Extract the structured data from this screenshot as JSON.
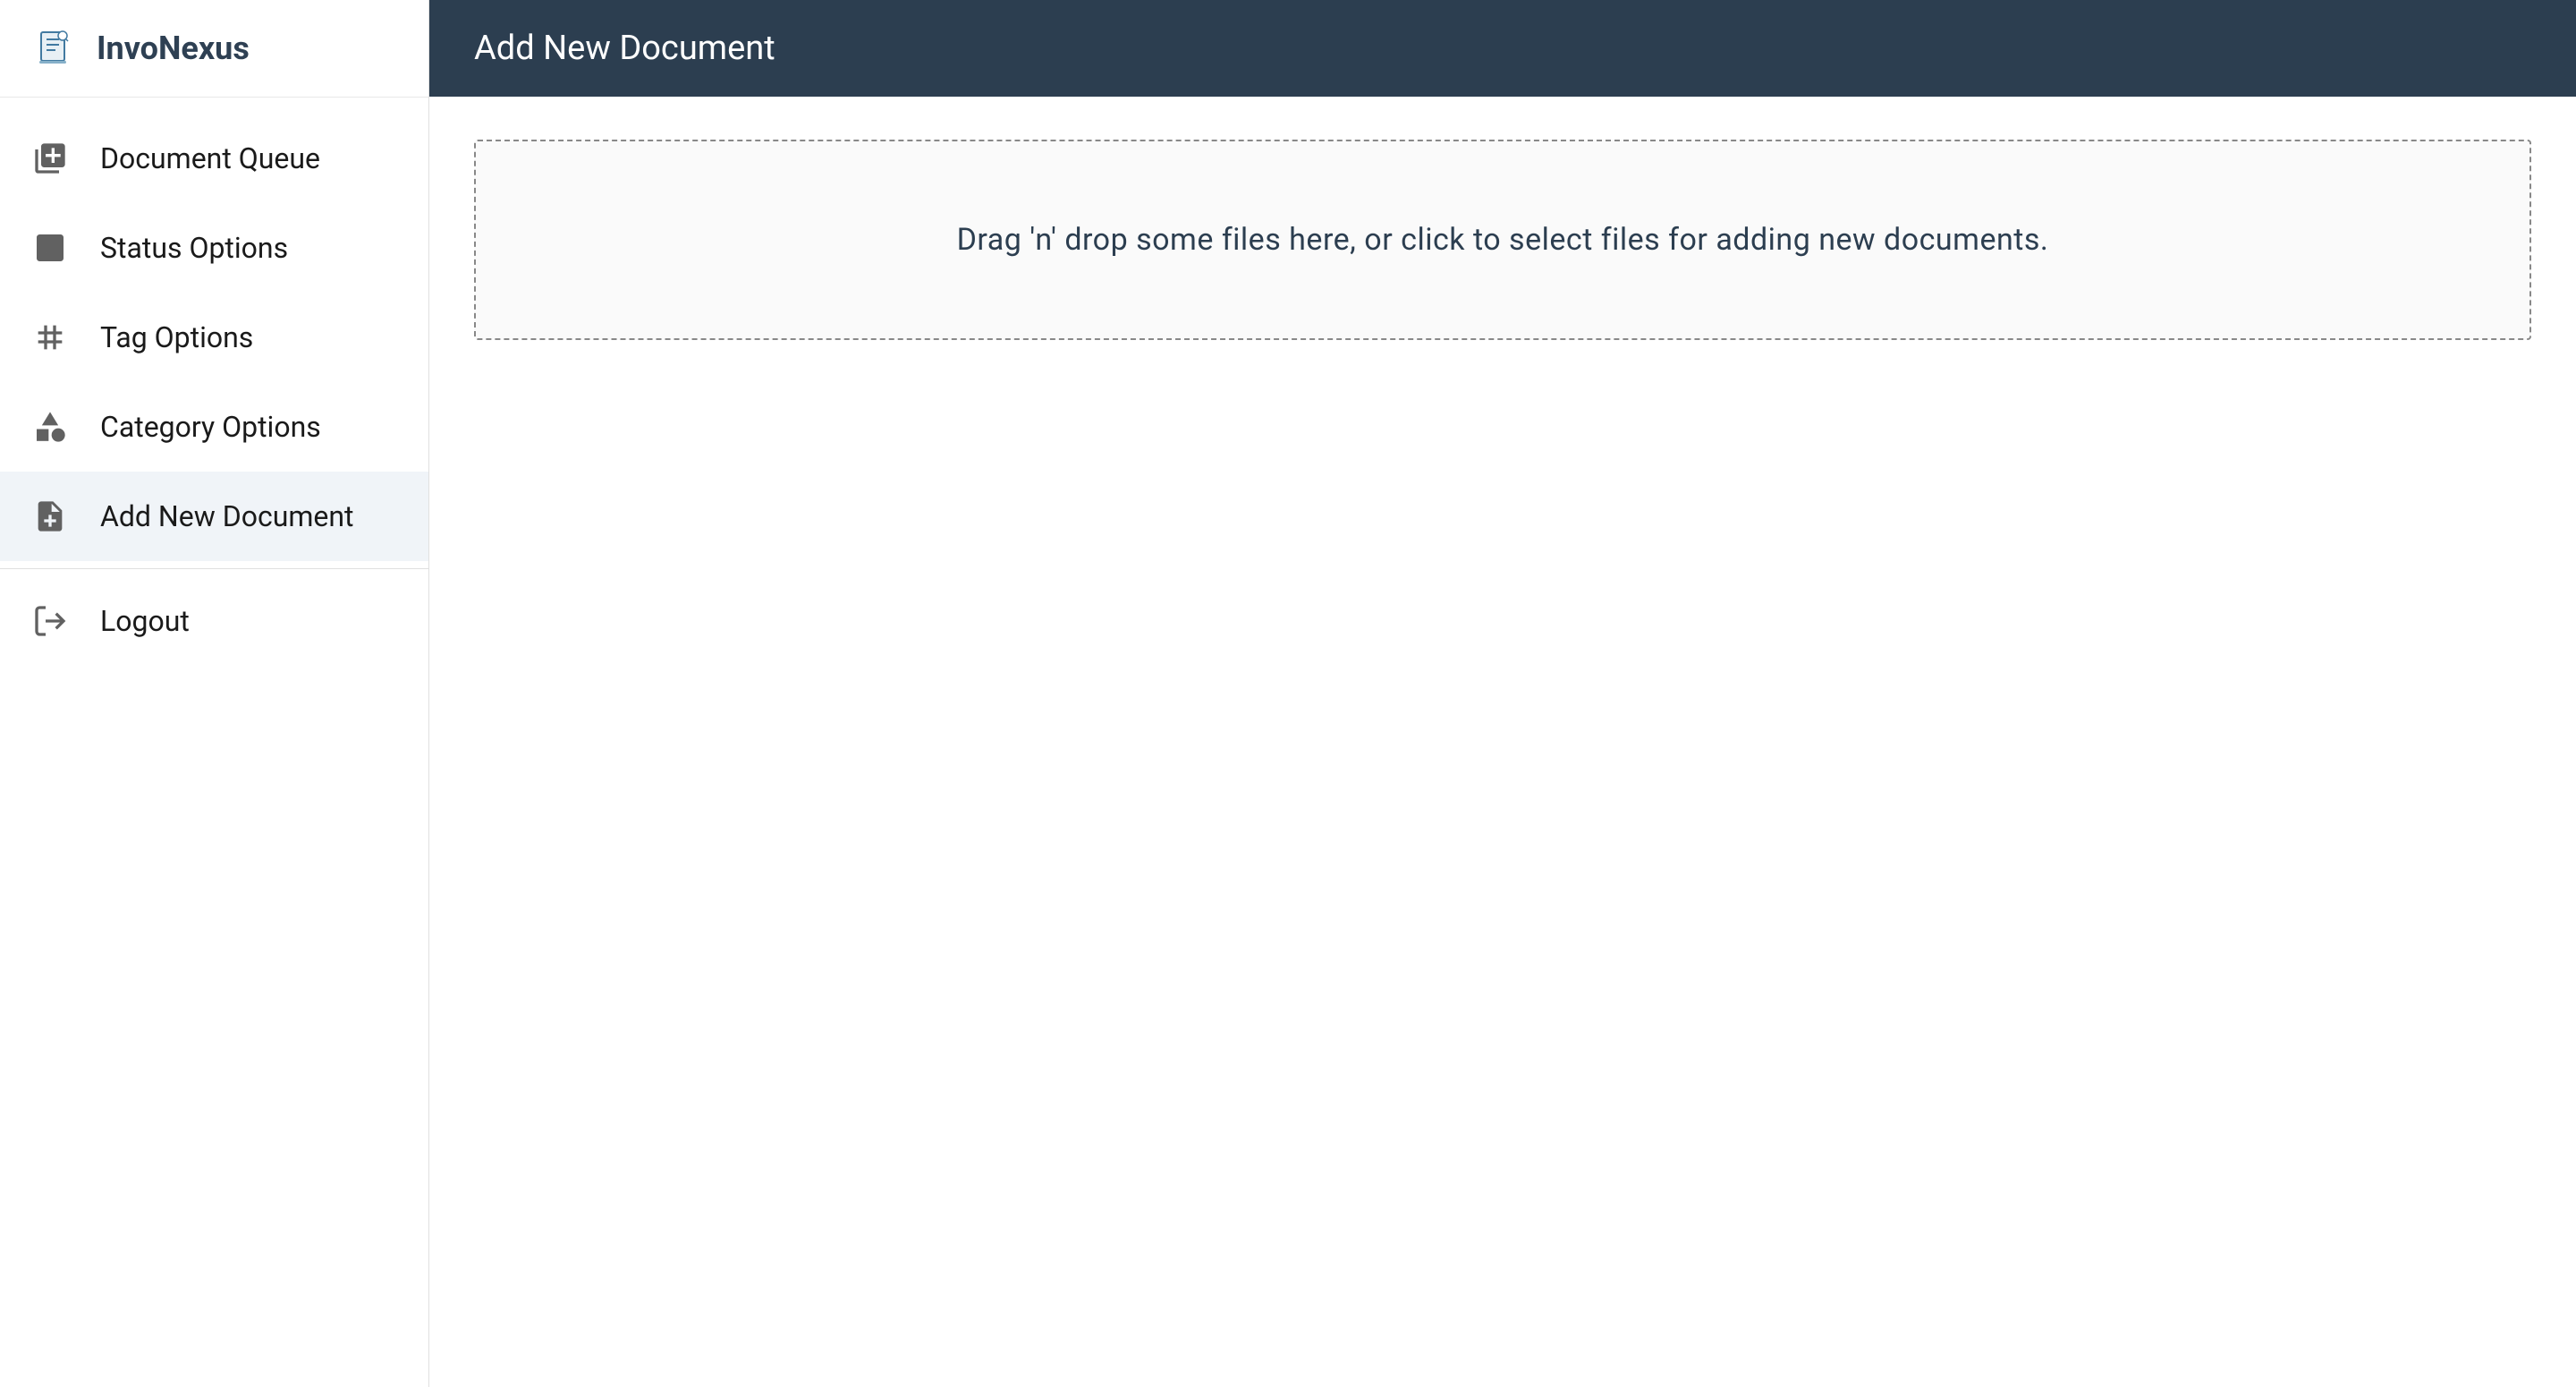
{
  "app": {
    "name": "InvoNexus"
  },
  "sidebar": {
    "items": [
      {
        "label": "Document Queue",
        "icon": "queue-icon",
        "active": false
      },
      {
        "label": "Status Options",
        "icon": "gear-box-icon",
        "active": false
      },
      {
        "label": "Tag Options",
        "icon": "hash-icon",
        "active": false
      },
      {
        "label": "Category Options",
        "icon": "shapes-icon",
        "active": false
      },
      {
        "label": "Add New Document",
        "icon": "note-add-icon",
        "active": true
      }
    ],
    "logout_label": "Logout"
  },
  "header": {
    "title": "Add New Document"
  },
  "dropzone": {
    "text": "Drag 'n' drop some files here, or click to select files for adding new documents."
  }
}
